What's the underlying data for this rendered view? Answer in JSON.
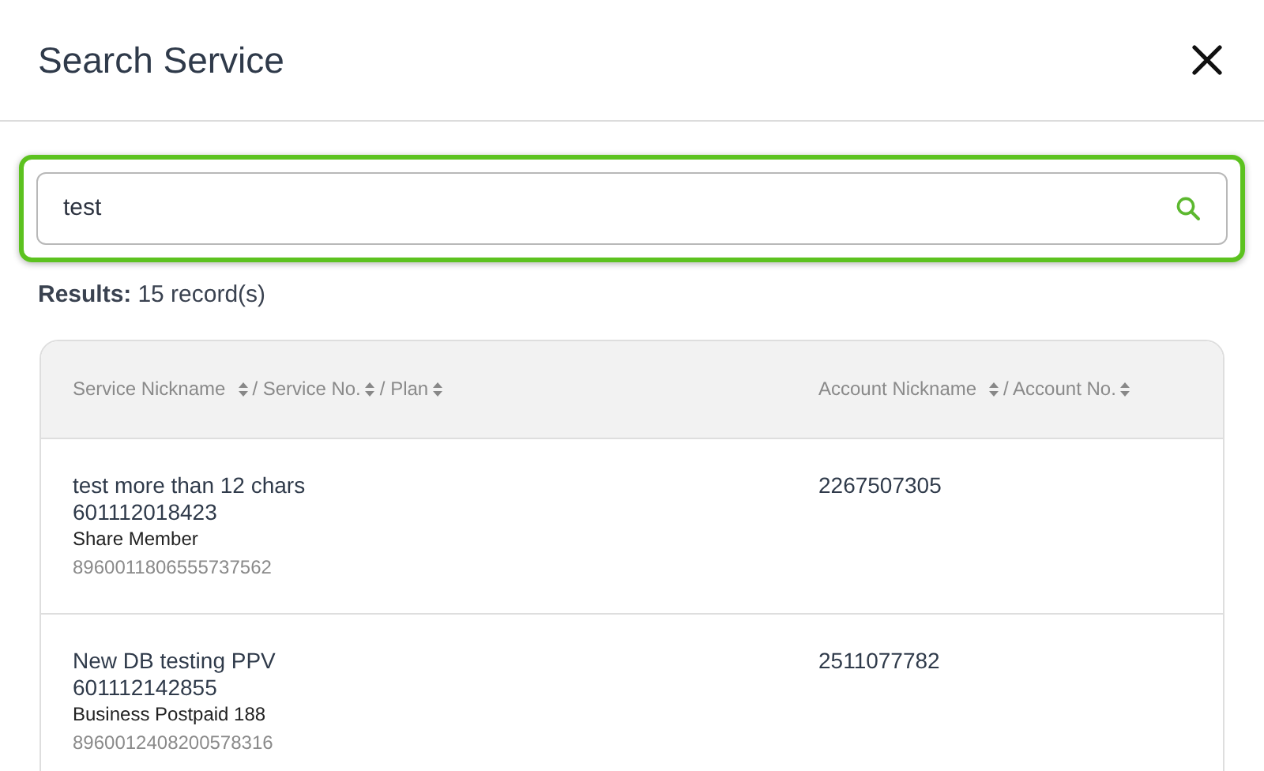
{
  "dialog": {
    "title": "Search Service"
  },
  "search": {
    "value": "test",
    "focused": true
  },
  "results": {
    "label": "Results:",
    "count": "15 record(s)"
  },
  "table": {
    "columns": [
      {
        "segments": [
          "Service Nickname",
          "/ Service No.",
          "/ Plan"
        ]
      },
      {
        "segments": [
          "Account Nickname",
          "/ Account No."
        ]
      }
    ],
    "rows": [
      {
        "nickname": "test more than 12 chars",
        "service_no": "601112018423",
        "plan": "Share Member",
        "sim": "8960011806555737562",
        "account": "2267507305"
      },
      {
        "nickname": "New DB testing PPV",
        "service_no": "601112142855",
        "plan": "Business Postpaid 188",
        "sim": "8960012408200578316",
        "account": "2511077782"
      }
    ]
  }
}
